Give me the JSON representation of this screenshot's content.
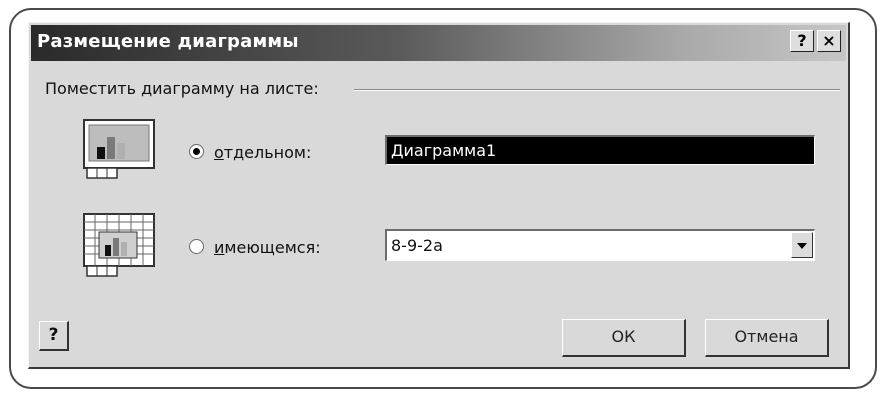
{
  "dialog": {
    "title": "Размещение диаграммы",
    "help_button_label": "?",
    "close_button_label": "×"
  },
  "group": {
    "label": "Поместить диаграмму на листе:"
  },
  "options": [
    {
      "prefix": "",
      "accel": "о",
      "rest": "тдельном:",
      "checked": true
    },
    {
      "prefix": "",
      "accel": "и",
      "rest": "меющемся:",
      "checked": false
    }
  ],
  "new_sheet_name": {
    "value": "Диаграмма1"
  },
  "existing_sheet": {
    "selected": "8-9-2a"
  },
  "buttons": {
    "ok": "ОК",
    "cancel": "Отмена",
    "help_glyph": "?"
  }
}
